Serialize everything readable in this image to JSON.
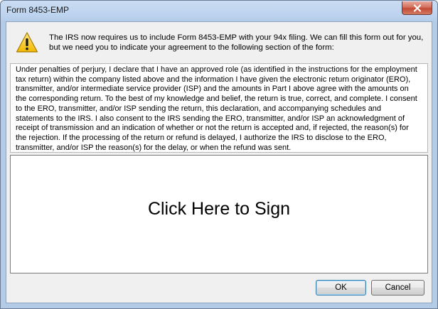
{
  "window": {
    "title": "Form 8453-EMP",
    "close_icon": "close-icon"
  },
  "notice": {
    "icon": "warning-icon",
    "text": "The IRS now requires us to include Form 8453-EMP with your 94x filing. We can fill this form out for you, but we need you to indicate your agreement to the following section of the form:"
  },
  "legal": {
    "text": "Under penalties of perjury, I declare that I have an approved role (as identified in the instructions for the employment tax return) within the company listed above and the information I have given the electronic return originator (ERO), transmitter, and/or intermediate service provider (ISP) and the amounts in Part I above agree with the amounts on the corresponding return. To the best of my knowledge and belief, the return is true, correct, and complete. I consent to the ERO, transmitter, and/or ISP sending the return, this declaration, and accompanying schedules and statements to the IRS. I also consent to the IRS sending the ERO, transmitter, and/or ISP an acknowledgment of receipt of transmission and an indication of whether or not the return is accepted and, if rejected, the reason(s) for the rejection. If the processing of the return or refund is delayed, I authorize the IRS to disclose to the ERO, transmitter, and/or ISP the reason(s) for the delay, or when the refund was sent."
  },
  "signature": {
    "prompt": "Click Here to Sign"
  },
  "buttons": {
    "ok_label": "OK",
    "cancel_label": "Cancel"
  }
}
